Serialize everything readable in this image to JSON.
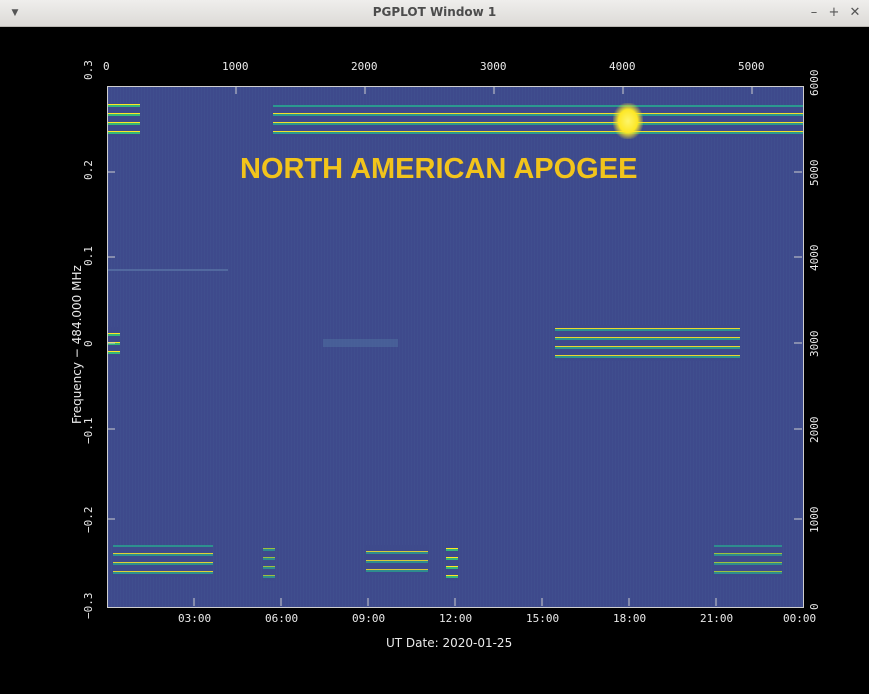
{
  "window": {
    "title": "PGPLOT Window 1"
  },
  "overlay": {
    "caption": "NORTH AMERICAN APOGEE"
  },
  "axes": {
    "xlabel": "UT Date: 2020-01-25",
    "ylabel": "Frequency − 484.000 MHz",
    "bottom_ticks": [
      "03:00",
      "06:00",
      "09:00",
      "12:00",
      "15:00",
      "18:00",
      "21:00",
      "00:00"
    ],
    "top_ticks": [
      "0",
      "1000",
      "2000",
      "3000",
      "4000",
      "5000"
    ],
    "left_ticks": [
      "0.3",
      "0.2",
      "0.1",
      "0",
      "−0.1",
      "−0.2",
      "−0.3"
    ],
    "right_ticks": [
      "6000",
      "5000",
      "4000",
      "3000",
      "2000",
      "1000",
      "0"
    ]
  },
  "colors": {
    "background": "#3e4a8c",
    "accent": "#f2c41b",
    "signal_low": "#2a9d8f",
    "signal_high": "#fde725"
  }
}
